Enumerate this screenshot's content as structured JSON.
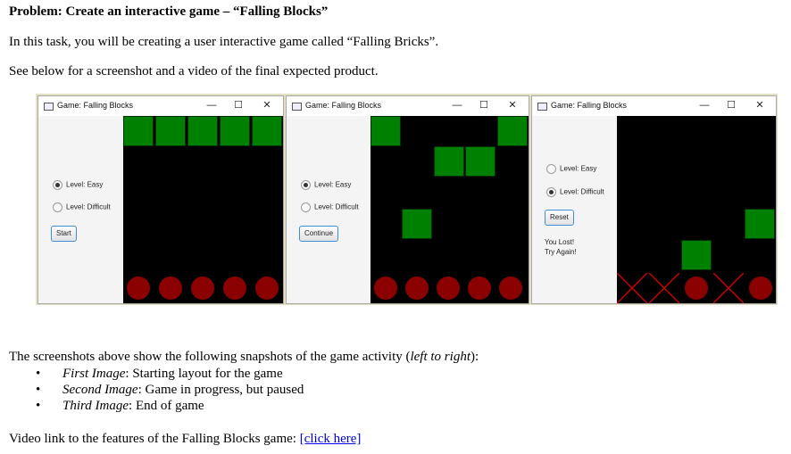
{
  "heading": "Problem: Create an interactive game – “Falling Blocks”",
  "intro": "In this task, you will be creating a user interactive game called “Falling Bricks”.",
  "see_below": "See below for a screenshot and a video of the final expected product.",
  "windows": [
    {
      "title": "Game: Falling Blocks",
      "controls": {
        "minimize": "—",
        "maximize": "☐",
        "close": "✕"
      },
      "radio_easy": "Level: Easy",
      "radio_difficult": "Level: Difficult",
      "selected_level": "easy",
      "button": "Start"
    },
    {
      "title": "Game: Falling Blocks",
      "controls": {
        "minimize": "—",
        "maximize": "☐",
        "close": "✕"
      },
      "radio_easy": "Level: Easy",
      "radio_difficult": "Level: Difficult",
      "selected_level": "easy",
      "button": "Continue"
    },
    {
      "title": "Game: Falling Blocks",
      "controls": {
        "minimize": "—",
        "maximize": "☐",
        "close": "✕"
      },
      "radio_easy": "Level: Easy",
      "radio_difficult": "Level: Difficult",
      "selected_level": "difficult",
      "button": "Reset",
      "message_line1": "You Lost!",
      "message_line2": "Try Again!"
    }
  ],
  "colors": {
    "block": "#008000",
    "ball": "#8b0000",
    "board": "#000000",
    "cross": "#cc0000"
  },
  "snapshots_intro_pre": "The screenshots above show the following snapshots of the game activity (",
  "snapshots_intro_italic": "left to right",
  "snapshots_intro_post": "):",
  "bullets": [
    {
      "label": "First Image",
      "text": ": Starting layout for the game"
    },
    {
      "label": "Second Image",
      "text": ": Game in progress, but paused"
    },
    {
      "label": "Third Image",
      "text": ": End of game"
    }
  ],
  "video_text": "Video link to the features of the Falling Blocks game: ",
  "video_link": "[click here]"
}
